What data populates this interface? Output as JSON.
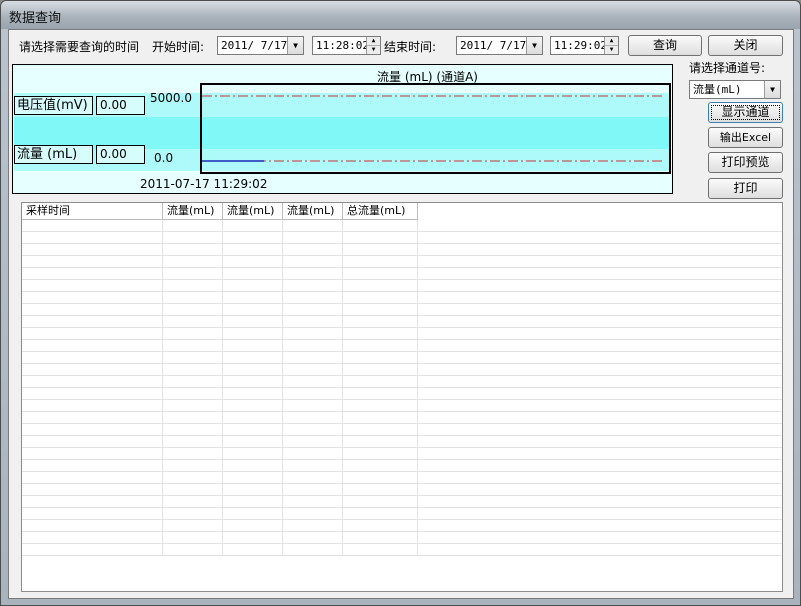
{
  "window": {
    "title": "数据查询"
  },
  "query": {
    "prompt": "请选择需要查询的时间",
    "start_label": "开始时间:",
    "start_date": "2011/ 7/17",
    "start_time": "11:28:02",
    "end_label": "结束时间:",
    "end_date": "2011/ 7/17",
    "end_time": "11:29:02",
    "query_button": "查询",
    "close_button": "关闭"
  },
  "channel": {
    "label": "请选择通道号:",
    "selected": "流量(mL)",
    "show_button": "显示通道",
    "export_button": "输出Excel",
    "preview_button": "打印预览",
    "print_button": "打印"
  },
  "chart": {
    "title": "流量 (mL) (通道A)",
    "voltage_label": "电压值(mV)",
    "voltage_value": "0.00",
    "flow_label": "流量 (mL)",
    "flow_value": "0.00",
    "y_top_label": "5000.0",
    "y_bottom_label": "0.0",
    "timestamp": "2011-07-17 11:29:02"
  },
  "chart_data": {
    "type": "line",
    "title": "流量 (mL) (通道A)",
    "ylim": [
      0,
      5000
    ],
    "ytick_labels": [
      "5000.0",
      "0.0"
    ],
    "x_label": "2011-07-17 11:29:02",
    "series": [
      {
        "style": "solid",
        "color": "#0000aa",
        "values": [
          0,
          0
        ]
      }
    ],
    "reference_lines": [
      {
        "value": 5000,
        "style": "dash-dot",
        "color": "#cc3333"
      },
      {
        "value": 0,
        "style": "dash-dot",
        "color": "#cc3333"
      }
    ]
  },
  "table": {
    "columns": [
      "采样时间",
      "流量(mL)",
      "流量(mL)",
      "流量(mL)",
      "总流量(mL)"
    ]
  },
  "colors": {
    "chart_bg": "#e6ffff",
    "band_light": "#aefafa",
    "band_dark": "#80f8f8",
    "ref_line": "#cc3333",
    "series_line": "#0000aa"
  }
}
